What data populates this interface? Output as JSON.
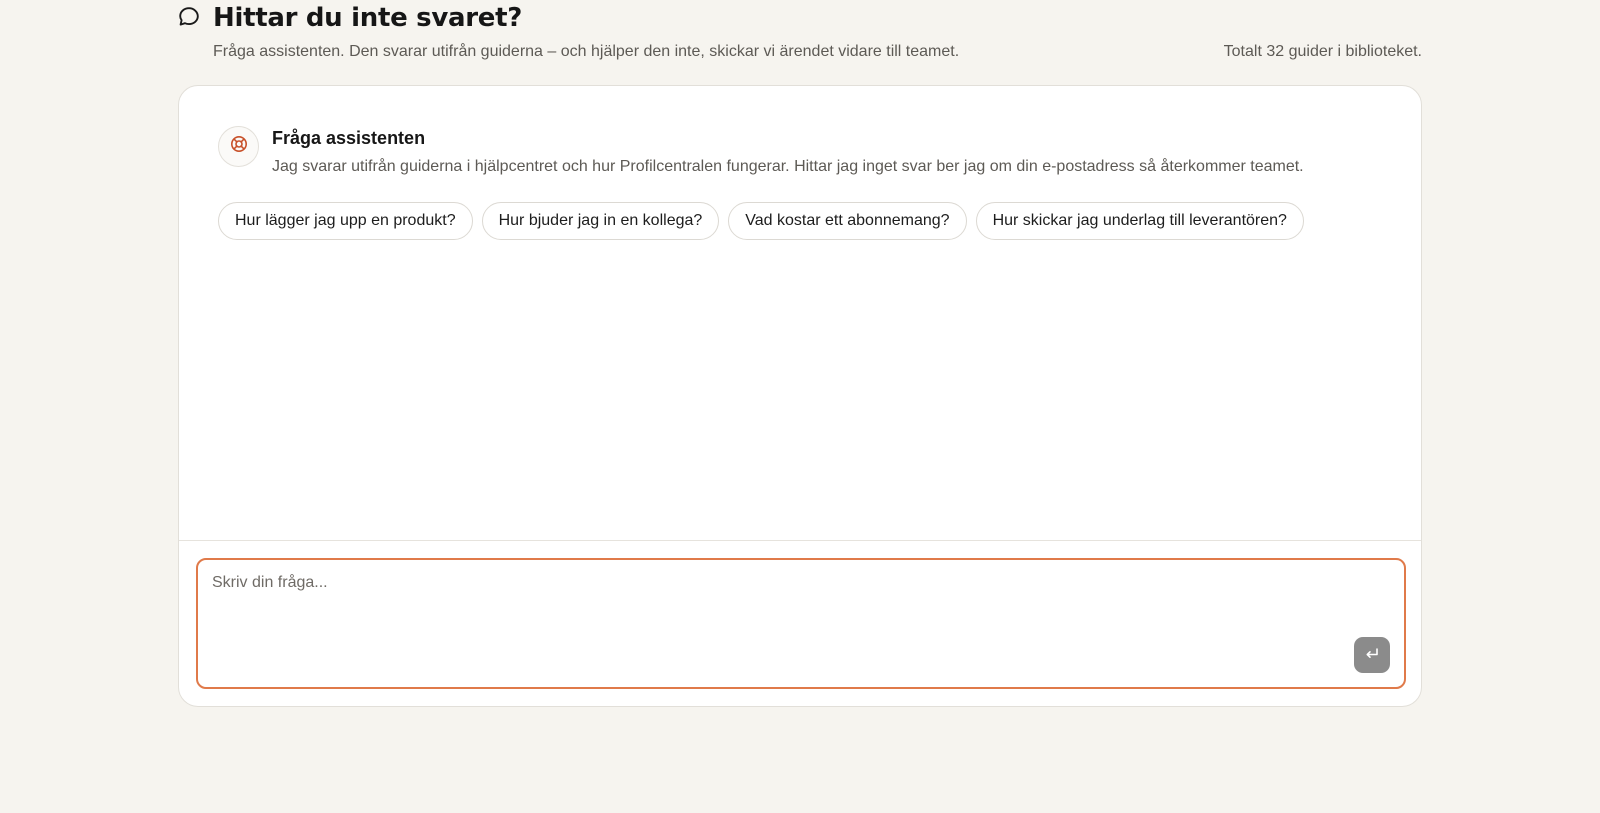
{
  "header": {
    "title": "Hittar du inte svaret?",
    "subtitle": "Fråga assistenten. Den svarar utifrån guiderna – och hjälper den inte, skickar vi ärendet vidare till teamet.",
    "count_text": "Totalt 32 guider i biblioteket.",
    "icon": "speech-bubble-icon"
  },
  "assistant": {
    "name": "Fråga assistenten",
    "description": "Jag svarar utifrån guiderna i hjälpcentret och hur Profilcentralen fungerar. Hittar jag inget svar ber jag om din e-postadress så återkommer teamet.",
    "icon": "lifebuoy-icon",
    "accent_color": "#c8512a"
  },
  "suggestions": [
    "Hur lägger jag upp en produkt?",
    "Hur bjuder jag in en kollega?",
    "Vad kostar ett abonnemang?",
    "Hur skickar jag underlag till leverantören?"
  ],
  "composer": {
    "placeholder": "Skriv din fråga...",
    "value": "",
    "border_color": "#e07a4a",
    "send_icon": "return-arrow-icon"
  }
}
